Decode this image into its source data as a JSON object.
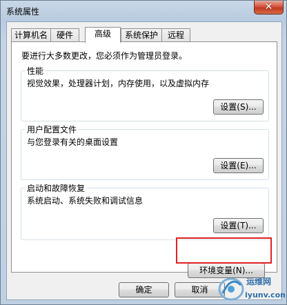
{
  "window": {
    "title": "系统属性",
    "close_glyph": "✕"
  },
  "tabs": [
    {
      "label": "计算机名"
    },
    {
      "label": "硬件"
    },
    {
      "label": "高级",
      "active": true
    },
    {
      "label": "系统保护"
    },
    {
      "label": "远程"
    }
  ],
  "advanced": {
    "admin_note": "要进行大多数更改，您必须作为管理员登录。",
    "performance": {
      "title": "性能",
      "description": "视觉效果，处理器计划，内存使用，以及虚拟内存",
      "button": "设置(S)..."
    },
    "user_profiles": {
      "title": "用户配置文件",
      "description": "与您登录有关的桌面设置",
      "button": "设置(E)..."
    },
    "startup_recovery": {
      "title": "启动和故障恢复",
      "description": "系统启动、系统失败和调试信息",
      "button": "设置(T)..."
    },
    "env_button": "环境变量(N)..."
  },
  "footer": {
    "ok": "确定",
    "cancel": "取消"
  },
  "watermark": {
    "line1": "运维网",
    "line2": "iyunv.com"
  },
  "colors": {
    "highlight": "#e02020"
  }
}
